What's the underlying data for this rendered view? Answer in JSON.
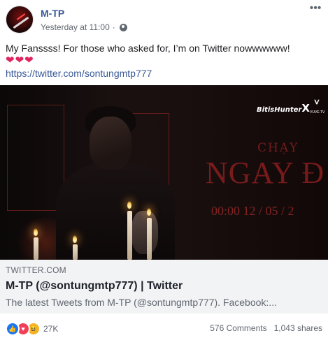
{
  "post": {
    "author": "M-TP",
    "timestamp": "Yesterday at 11:00",
    "separator": "·",
    "privacy_icon": "globe-icon",
    "more_icon": "more-options-icon",
    "text_line1": "My Fanssss! For those who asked for, I’m on Twitter nowwwwww!",
    "hearts": [
      "❤",
      "❤",
      "❤"
    ],
    "link_text": "https://twitter.com/sontungmtp777"
  },
  "preview": {
    "image_texts": {
      "chay": "CHẠY",
      "ngay": "NGAY Đ",
      "date": "00:00 12 / 05 / 2",
      "brand": "BitisHunter",
      "brand_x": "X",
      "vieon_text": "VUVE.TV"
    },
    "domain": "TWITTER.COM",
    "title": "M-TP (@sontungmtp777) | Twitter",
    "description": "The latest Tweets from M-TP (@sontungmtp777). Facebook:..."
  },
  "footer": {
    "reaction_count": "27K",
    "comments": "576 Comments",
    "shares": "1,043 shares",
    "reactions": [
      "like-icon",
      "love-icon",
      "haha-icon"
    ]
  },
  "colors": {
    "link_blue": "#385898",
    "meta_gray": "#616770",
    "like_blue": "#1877f2",
    "love_red": "#f33e58",
    "haha_yellow": "#f7b125",
    "preview_bg": "#f2f3f5"
  }
}
